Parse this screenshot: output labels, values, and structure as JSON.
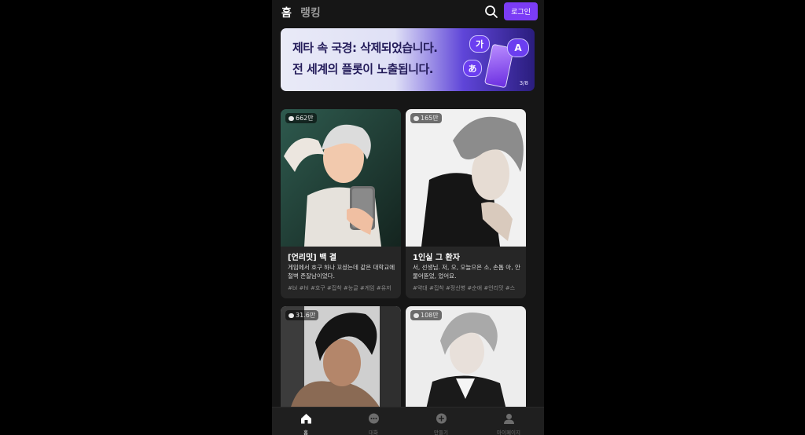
{
  "header": {
    "tabs": [
      {
        "label": "홈"
      },
      {
        "label": "랭킹"
      }
    ],
    "login_label": "로그인"
  },
  "banner": {
    "line1": "제타 속 국경: 삭제되었습니다.",
    "line2": "전 세계의 플롯이 노출됩니다.",
    "bubbles": [
      "가",
      "あ",
      "A"
    ],
    "pager": "3/8"
  },
  "cards": [
    {
      "count": "662만",
      "title": "[언리밋] 백 결",
      "desc": "게임에서 호구 하나 꼬셨는데 같은 대학교에 철벽 존잘남이었다.",
      "tags": "#bl #hl #호구 #집착 #능글 #게임 #유저"
    },
    {
      "count": "165만",
      "title": "1인실 그 환자",
      "desc": "서, 선생님. 저, 오, 오늘으은 소, 손톱 아, 안 물어뜯었, 었어요.",
      "tags": "#약대 #집착 #정신병 #순애 #언리밋 #스"
    },
    {
      "count": "31.6만",
      "title": "",
      "desc": "",
      "tags": ""
    },
    {
      "count": "108만",
      "title": "",
      "desc": "",
      "tags": ""
    }
  ],
  "tabbar": [
    {
      "label": "홈",
      "icon": "home-icon"
    },
    {
      "label": "대화",
      "icon": "chat-icon"
    },
    {
      "label": "만들기",
      "icon": "plus-circle-icon"
    },
    {
      "label": "마이페이지",
      "icon": "user-icon"
    }
  ]
}
